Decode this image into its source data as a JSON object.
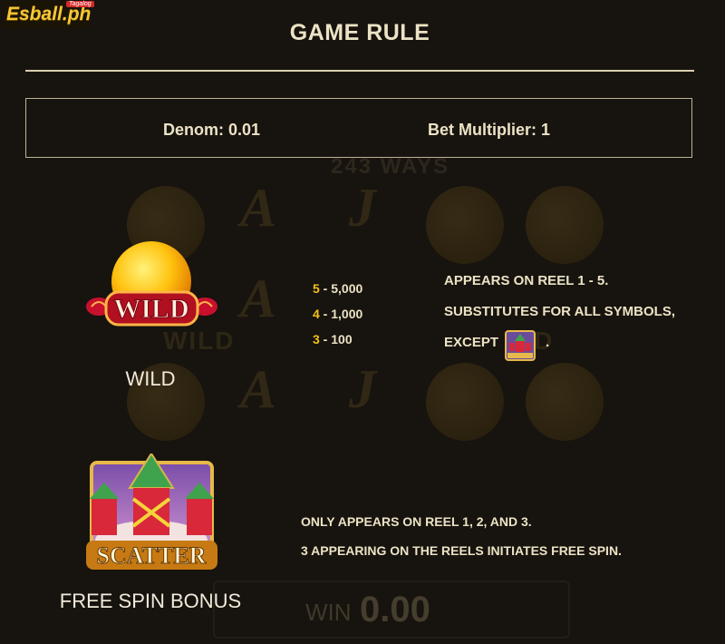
{
  "brand": {
    "name": "Esball.ph",
    "badge": "Tagalog"
  },
  "header": {
    "title": "GAME RULE"
  },
  "info": {
    "denom": "Denom: 0.01",
    "bet_multiplier": "Bet Multiplier: 1"
  },
  "wild": {
    "label": "WILD",
    "symbol_text": "WILD",
    "payouts": [
      {
        "count": "5",
        "value": "5,000"
      },
      {
        "count": "4",
        "value": "1,000"
      },
      {
        "count": "3",
        "value": "100"
      }
    ],
    "desc_line1": "APPEARS ON REEL 1 - 5.",
    "desc_line2": "SUBSTITUTES FOR ALL SYMBOLS,",
    "desc_line3": "EXCEPT",
    "desc_line3_end": "."
  },
  "scatter": {
    "label": "FREE SPIN BONUS",
    "symbol_text": "SCATTER",
    "desc_line1": "ONLY APPEARS ON REEL 1, 2, AND 3.",
    "desc_line2": "3 APPEARING ON THE REELS INITIATES FREE SPIN."
  },
  "background": {
    "title": "243 WAYS",
    "win_label": "WIN",
    "win_value": "0.00"
  },
  "colors": {
    "background": "#17130e",
    "text": "#ece3c5",
    "accent_yellow": "#f2c21a"
  }
}
